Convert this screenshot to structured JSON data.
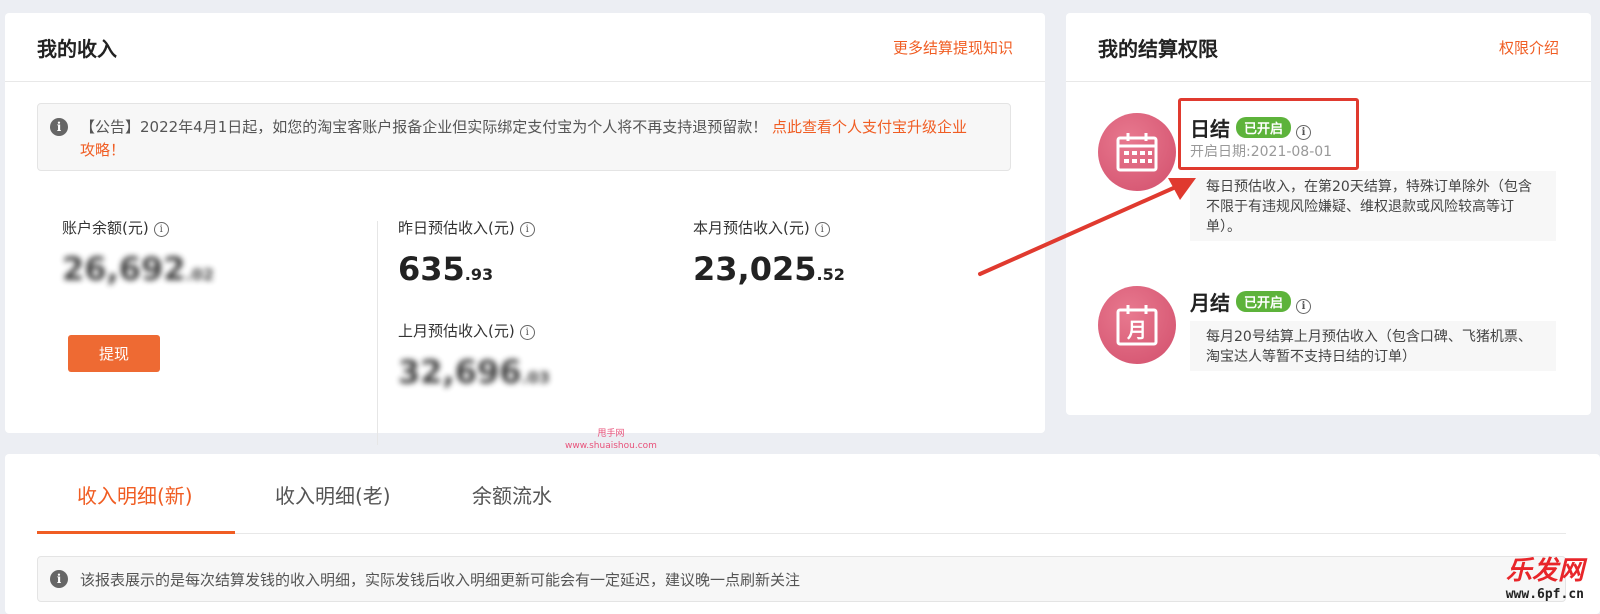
{
  "income": {
    "title": "我的收入",
    "more_link": "更多结算提现知识",
    "notice": "【公告】2022年4月1日起，如您的淘宝客账户报备企业但实际绑定支付宝为个人将不再支持退预留款！",
    "notice_link": "点此查看个人支付宝升级企业攻略！",
    "balance": {
      "label": "账户余额(元)",
      "value_int": "26,692",
      "value_frac": ".02"
    },
    "yesterday": {
      "label": "昨日预估收入(元)",
      "value_int": "635",
      "value_frac": ".93"
    },
    "this_month": {
      "label": "本月预估收入(元)",
      "value_int": "23,025",
      "value_frac": ".52"
    },
    "last_month": {
      "label": "上月预估收入(元)",
      "value_int": "32,696",
      "value_frac": ".03"
    },
    "withdraw_button": "提现"
  },
  "settlement": {
    "title": "我的结算权限",
    "intro_link": "权限介绍",
    "daily": {
      "name": "日结",
      "badge": "已开启",
      "date": "开启日期:2021-08-01",
      "desc": "每日预估收入，在第20天结算，特殊订单除外（包含不限于有违规风险嫌疑、维权退款或风险较高等订单）。"
    },
    "monthly": {
      "name": "月结",
      "icon_char": "月",
      "badge": "已开启",
      "desc": "每月20号结算上月预估收入（包含口碑、飞猪机票、淘宝达人等暂不支持日结的订单）"
    }
  },
  "tabs": [
    {
      "label": "收入明细(新)",
      "active": true
    },
    {
      "label": "收入明细(老)",
      "active": false
    },
    {
      "label": "余额流水",
      "active": false
    }
  ],
  "detail_notice": "该报表展示的是每次结算发钱的收入明细，实际发钱后收入明细更新可能会有一定延迟，建议晚一点刷新关注",
  "watermark": {
    "line1": "甩手网",
    "line2": "www.shuaishou.com"
  },
  "logo": {
    "text": "乐发网",
    "url": "www.6pf.cn"
  },
  "colors": {
    "accent": "#f05d23",
    "badge_green": "#5db33b",
    "icon_pink": "#d9566f",
    "annotation_red": "#e03a2f"
  }
}
